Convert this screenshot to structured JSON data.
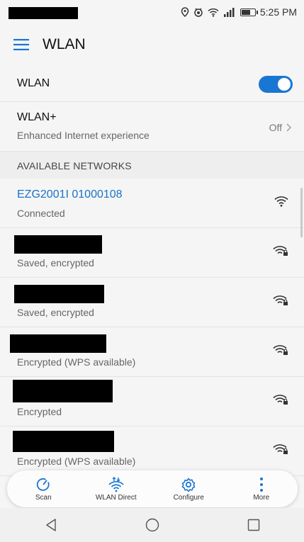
{
  "status_bar": {
    "time": "5:25 PM"
  },
  "header": {
    "title": "WLAN"
  },
  "wlan": {
    "label": "WLAN",
    "enabled": true
  },
  "wlan_plus": {
    "label": "WLAN+",
    "subtitle": "Enhanced Internet experience",
    "value": "Off"
  },
  "available": {
    "header": "AVAILABLE NETWORKS"
  },
  "networks": [
    {
      "name": "EZG2001I 01000108",
      "status": "Connected",
      "secured": false
    },
    {
      "name": "",
      "status": "Saved, encrypted",
      "secured": true
    },
    {
      "name": "",
      "status": "Saved, encrypted",
      "secured": true
    },
    {
      "name": "",
      "status": "Encrypted (WPS available)",
      "secured": true
    },
    {
      "name": "",
      "status": "Encrypted",
      "secured": true
    },
    {
      "name": "",
      "status": "Encrypted (WPS available)",
      "secured": true
    }
  ],
  "actions": [
    {
      "label": "Scan",
      "icon": "scan-icon"
    },
    {
      "label": "WLAN Direct",
      "icon": "wlan-direct-icon"
    },
    {
      "label": "Configure",
      "icon": "gear-icon"
    },
    {
      "label": "More",
      "icon": "more-vertical-icon"
    }
  ],
  "colors": {
    "accent": "#1976d2",
    "link": "#1a73c8"
  }
}
